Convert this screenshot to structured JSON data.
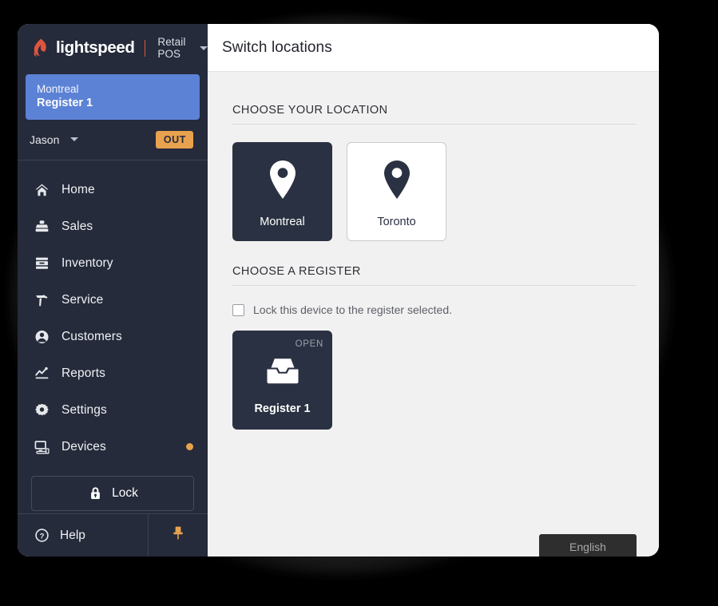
{
  "brand": {
    "logo_icon": "lightspeed-flame-icon",
    "name": "lightspeed",
    "product": "Retail POS",
    "product_caret_icon": "chevron-down-icon"
  },
  "sidebar": {
    "location_chip": {
      "location": "Montreal",
      "register": "Register 1"
    },
    "user": {
      "name": "Jason",
      "caret_icon": "chevron-down-icon",
      "status_badge": "OUT"
    },
    "nav_items": [
      {
        "label": "Home",
        "icon": "home-icon",
        "badge": false
      },
      {
        "label": "Sales",
        "icon": "sales-icon",
        "badge": false
      },
      {
        "label": "Inventory",
        "icon": "inventory-icon",
        "badge": false
      },
      {
        "label": "Service",
        "icon": "service-icon",
        "badge": false
      },
      {
        "label": "Customers",
        "icon": "customers-icon",
        "badge": false
      },
      {
        "label": "Reports",
        "icon": "reports-icon",
        "badge": false
      },
      {
        "label": "Settings",
        "icon": "settings-icon",
        "badge": false
      },
      {
        "label": "Devices",
        "icon": "devices-icon",
        "badge": true
      }
    ],
    "lock_button": {
      "label": "Lock",
      "icon": "padlock-icon"
    },
    "help": {
      "label": "Help",
      "icon": "question-circle-icon"
    },
    "pin": {
      "icon": "pin-icon"
    }
  },
  "header": {
    "title": "Switch locations"
  },
  "main": {
    "location_section": {
      "title": "CHOOSE YOUR LOCATION",
      "tiles": [
        {
          "label": "Montreal",
          "icon": "map-pin-icon",
          "selected": true
        },
        {
          "label": "Toronto",
          "icon": "map-pin-icon",
          "selected": false
        }
      ]
    },
    "register_section": {
      "title": "CHOOSE A REGISTER",
      "lock_checkbox": {
        "label": "Lock this device to the register selected.",
        "checked": false
      },
      "tiles": [
        {
          "label": "Register 1",
          "status": "OPEN",
          "icon": "cash-drawer-icon",
          "selected": true
        }
      ]
    },
    "language_button": {
      "label": "English"
    }
  },
  "colors": {
    "sidebar_bg": "#252b3b",
    "active_chip": "#5c82d6",
    "accent_orange": "#e8a24e",
    "brand_red": "#e0543f",
    "card_dark": "#2a3142",
    "content_bg": "#f1f1f1"
  }
}
